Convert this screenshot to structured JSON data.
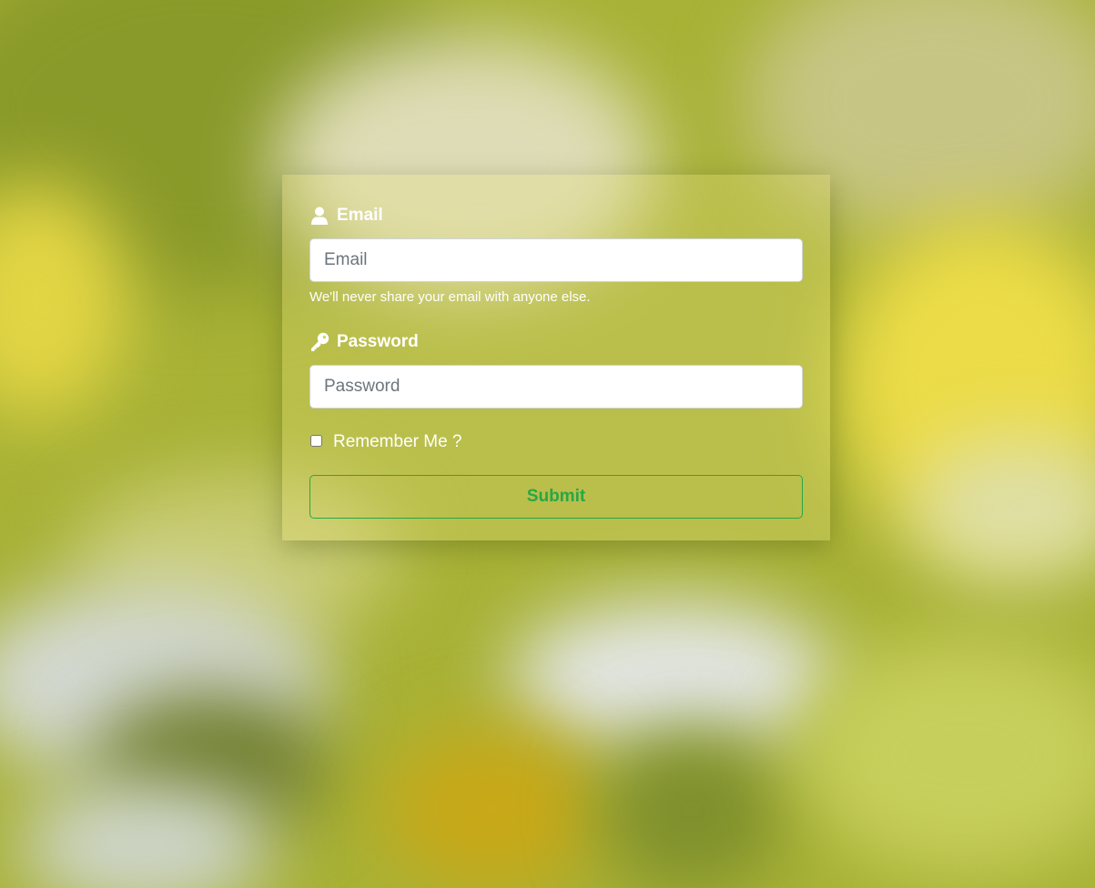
{
  "form": {
    "email": {
      "label": "Email",
      "placeholder": "Email",
      "value": "",
      "help_text": "We'll never share your email with anyone else.",
      "icon": "user-icon"
    },
    "password": {
      "label": "Password",
      "placeholder": "Password",
      "value": "",
      "icon": "key-icon"
    },
    "remember": {
      "label": "Remember Me ?",
      "checked": false
    },
    "submit_label": "Submit"
  },
  "colors": {
    "accent": "#28a745",
    "label_text": "#ffffff",
    "input_border": "#ced4da"
  }
}
